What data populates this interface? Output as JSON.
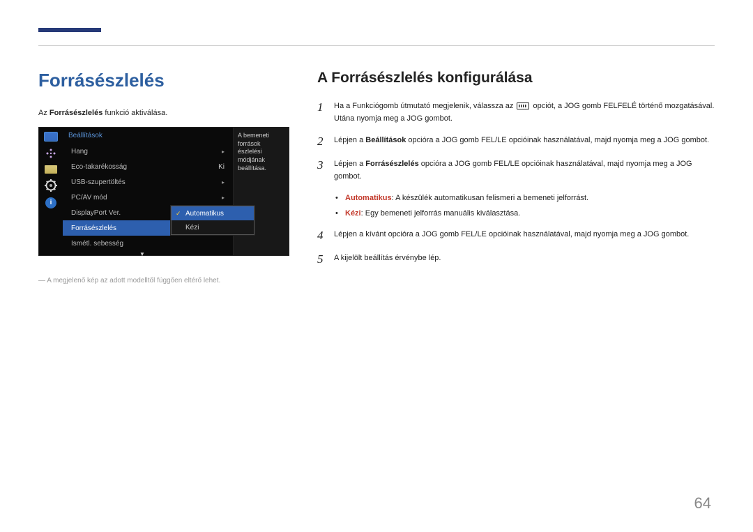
{
  "page_number": "64",
  "left": {
    "title": "Forrásészlelés",
    "intro_pre": "Az ",
    "intro_bold": "Forrásészlelés",
    "intro_post": " funkció aktiválása.",
    "note": "― A megjelenő kép az adott modelltől függően eltérő lehet.",
    "osd": {
      "title": "Beállítások",
      "right_text": "A bemeneti források észlelési módjának beállítása.",
      "items": [
        {
          "label": "Hang",
          "value": "",
          "arrow": "▸"
        },
        {
          "label": "Eco-takarékosság",
          "value": "Ki",
          "arrow": ""
        },
        {
          "label": "USB-szupertöltés",
          "value": "",
          "arrow": "▸"
        },
        {
          "label": "PC/AV mód",
          "value": "",
          "arrow": "▸"
        },
        {
          "label": "DisplayPort Ver.",
          "value": "",
          "arrow": "▸"
        },
        {
          "label": "Forrásészlelés",
          "value": "",
          "arrow": ""
        },
        {
          "label": "Ismétl. sebesség",
          "value": "",
          "arrow": ""
        }
      ],
      "popup": [
        {
          "label": "Automatikus",
          "selected": true
        },
        {
          "label": "Kézi",
          "selected": false
        }
      ],
      "info_char": "i",
      "scroll": "▼"
    }
  },
  "right": {
    "title": "A Forrásészlelés konfigurálása",
    "step1_a": "Ha a Funkciógomb útmutató megjelenik, válassza az ",
    "step1_b": " opciót, a JOG gomb FELFELÉ történő mozgatásával. Utána nyomja meg a JOG gombot.",
    "step2_a": "Lépjen a ",
    "step2_bold": "Beállítások",
    "step2_b": " opcióra a JOG gomb FEL/LE opcióinak használatával, majd nyomja meg a JOG gombot.",
    "step3_a": "Lépjen a ",
    "step3_bold": "Forrásészlelés",
    "step3_b": " opcióra a JOG gomb FEL/LE opcióinak használatával, majd nyomja meg a JOG gombot.",
    "bullet1_bold": "Automatikus",
    "bullet1_text": ": A készülék automatikusan felismeri a bemeneti jelforrást.",
    "bullet2_bold": "Kézi",
    "bullet2_text": ": Egy bemeneti jelforrás manuális kiválasztása.",
    "step4": "Lépjen a kívánt opcióra a JOG gomb FEL/LE opcióinak használatával, majd nyomja meg a JOG gombot.",
    "step5": "A kijelölt beállítás érvénybe lép.",
    "nums": {
      "1": "1",
      "2": "2",
      "3": "3",
      "4": "4",
      "5": "5"
    },
    "dot": "•"
  }
}
